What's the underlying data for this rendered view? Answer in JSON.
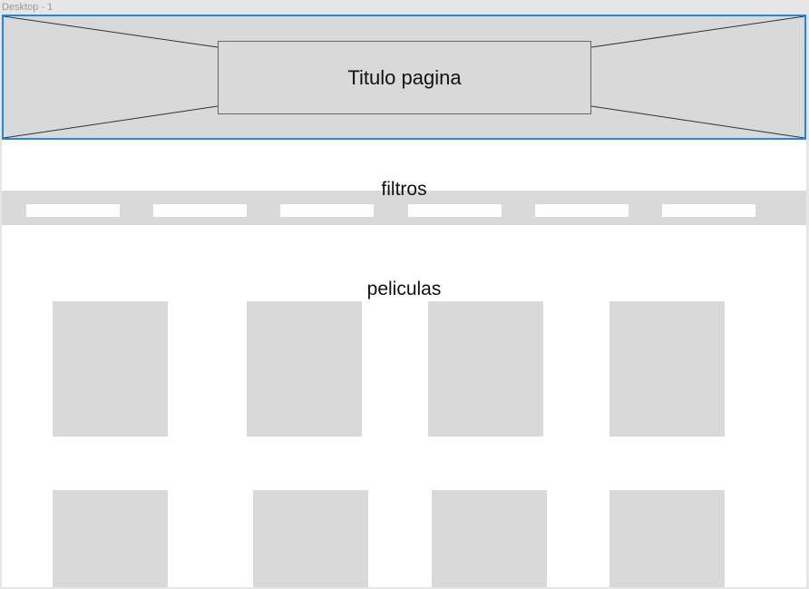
{
  "window": {
    "frame_name": "Desktop - 1"
  },
  "hero": {
    "title": "Titulo pagina",
    "placeholder_icon": "image-placeholder-cross"
  },
  "filters": {
    "label": "filtros",
    "chip_count": 6
  },
  "movies": {
    "label": "peliculas",
    "poster_count": 8
  },
  "colors": {
    "placeholder_gray": "#d9d9d9",
    "selection_blue": "#1e88e5",
    "background": "#ffffff"
  }
}
